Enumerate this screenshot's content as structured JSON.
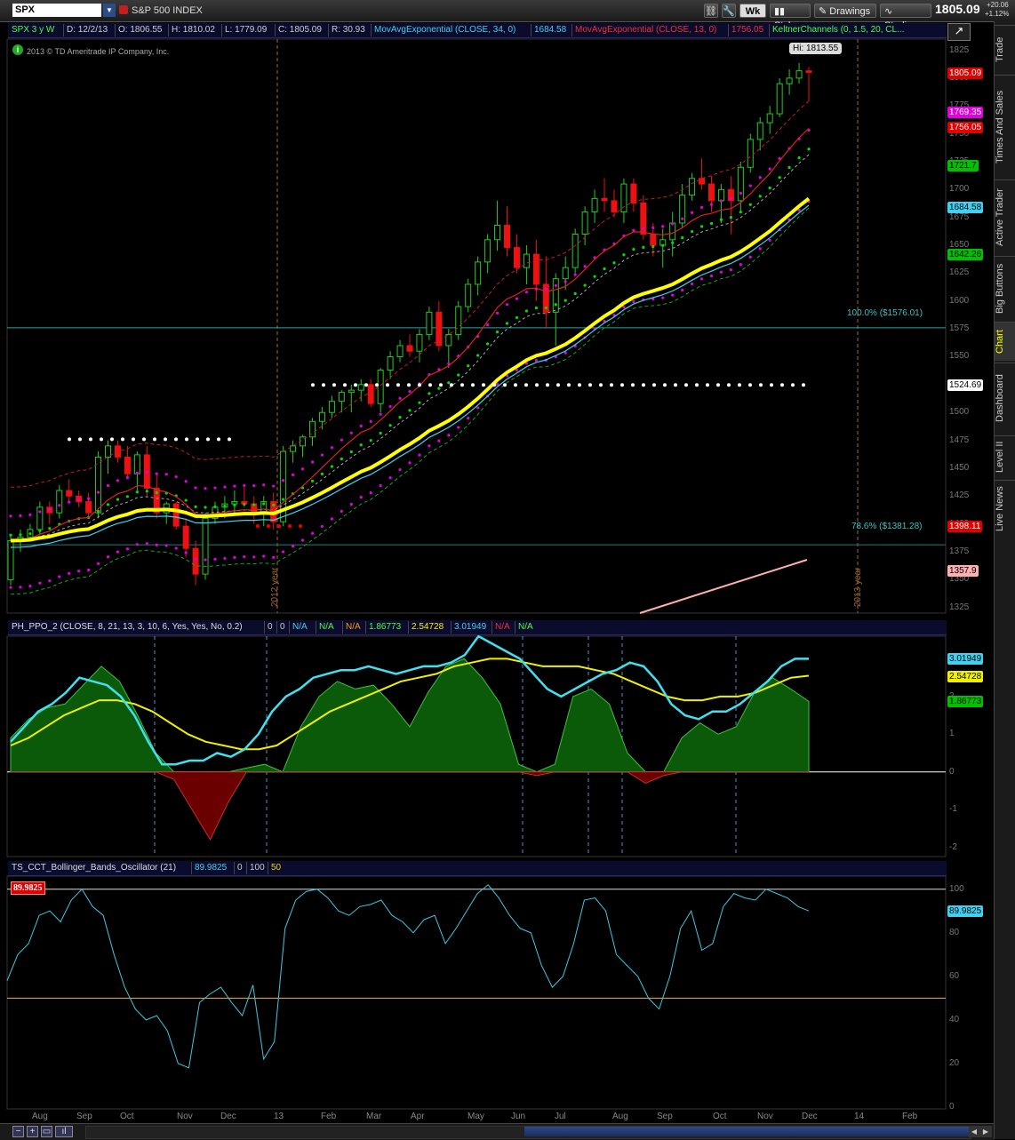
{
  "toolbar": {
    "symbol": "SPX",
    "description": "S&P 500 INDEX",
    "period_label": "Wk",
    "style_label": "Style",
    "drawings_label": "Drawings",
    "studies_label": "Studies",
    "last_price": "1805.09",
    "change": "+20.06",
    "change_pct": "+1.12%"
  },
  "sidebar": {
    "tabs": [
      "Trade",
      "Times And Sales",
      "Active Trader",
      "Big Buttons",
      "Chart",
      "Dashboard",
      "Level II",
      "Live News"
    ],
    "active": "Chart"
  },
  "price_panel": {
    "header": {
      "label": "SPX 3 y W",
      "date": "D: 12/2/13",
      "open": "O: 1806.55",
      "high": "H: 1810.02",
      "low": "L: 1779.09",
      "close": "C: 1805.09",
      "range": "R: 30.93",
      "ema34_label": "MovAvgExponential (CLOSE, 34, 0)",
      "ema34_value": "1684.58",
      "ema13_label": "MovAvgExponential (CLOSE, 13, 0)",
      "ema13_value": "1756.05",
      "keltner_label": "KeltnerChannels (0, 1.5, 20, CL..."
    },
    "copyright": "2013 © TD Ameritrade IP Company, Inc.",
    "hi_label": "Hi: 1813.55",
    "fib_100_label": "100.0%  ($1576.01)",
    "fib_786_label": "78.6%  ($1381.28)",
    "year_2012_label": "2012 year",
    "year_2013_label": "2013 year",
    "y_ticks": [
      1825,
      1800,
      1775,
      1750,
      1725,
      1700,
      1675,
      1650,
      1625,
      1600,
      1575,
      1550,
      1525,
      1500,
      1475,
      1450,
      1425,
      1400,
      1375,
      1350,
      1325
    ],
    "price_tags": [
      {
        "text": "1805.09",
        "bg": "#e00000",
        "fg": "#ffffff",
        "value": 1805.09
      },
      {
        "text": "1769.35",
        "bg": "#e000e0",
        "fg": "#ffffff",
        "value": 1769.35
      },
      {
        "text": "1756.05",
        "bg": "#e00000",
        "fg": "#ffffff",
        "value": 1756.05
      },
      {
        "text": "1721.7",
        "bg": "#00c000",
        "fg": "#000000",
        "value": 1721.7
      },
      {
        "text": "1684.58",
        "bg": "#40d0f0",
        "fg": "#000000",
        "value": 1684.58
      },
      {
        "text": "1642.26",
        "bg": "#00c000",
        "fg": "#000000",
        "value": 1642.26
      },
      {
        "text": "1524.69",
        "bg": "#ffffff",
        "fg": "#000000",
        "value": 1524.69
      },
      {
        "text": "1398.11",
        "bg": "#e00000",
        "fg": "#ffffff",
        "value": 1398.11
      },
      {
        "text": "1357.9",
        "bg": "#ffb0b0",
        "fg": "#000000",
        "value": 1357.9
      }
    ]
  },
  "ppo_panel": {
    "header": {
      "name": "PH_PPO_2 (CLOSE, 8, 21, 13, 3, 10, 6, Yes, Yes, No, 0.2)",
      "v1": "0",
      "v2": "0",
      "v3": "N/A",
      "v4": "N/A",
      "v5": "1.86773",
      "v6": "2.54728",
      "v7": "3.01949",
      "v8": "N/A",
      "v9": "N/A"
    },
    "y_ticks": [
      2,
      1,
      0,
      -1,
      -2
    ],
    "tags": [
      {
        "text": "3.01949",
        "bg": "#40d0f0",
        "fg": "#000000",
        "value": 3.01949
      },
      {
        "text": "2.54728",
        "bg": "#f0f000",
        "fg": "#000000",
        "value": 2.54728
      },
      {
        "text": "1.86773",
        "bg": "#00c000",
        "fg": "#000000",
        "value": 1.86773
      }
    ]
  },
  "bbo_panel": {
    "header": {
      "name": "TS_CCT_Bollinger_Bands_Oscillator (21)",
      "value": "89.9825",
      "p1": "0",
      "p2": "100",
      "p3": "50"
    },
    "value_box": "89.9825",
    "y_ticks": [
      100,
      80,
      60,
      40,
      20,
      0
    ],
    "tags": [
      {
        "text": "89.9825",
        "bg": "#40d0f0",
        "fg": "#000000",
        "value": 89.9825
      }
    ]
  },
  "x_axis": {
    "labels": [
      "Aug",
      "Sep",
      "Oct",
      "Nov",
      "Dec",
      "13",
      "Feb",
      "Mar",
      "Apr",
      "May",
      "Jun",
      "Jul",
      "Aug",
      "Sep",
      "Oct",
      "Nov",
      "Dec",
      "14",
      "Feb"
    ]
  },
  "chart_data": [
    {
      "type": "candlestick",
      "title": "SPX 3 y W",
      "timeframe": "weekly",
      "x_start": "2012-07-23",
      "ylim": [
        1320,
        1835
      ],
      "candles_ohlc": [
        [
          1350,
          1390,
          1345,
          1385
        ],
        [
          1385,
          1395,
          1375,
          1388
        ],
        [
          1388,
          1400,
          1385,
          1395
        ],
        [
          1395,
          1420,
          1390,
          1415
        ],
        [
          1415,
          1420,
          1400,
          1410
        ],
        [
          1410,
          1435,
          1405,
          1430
        ],
        [
          1430,
          1440,
          1420,
          1425
        ],
        [
          1425,
          1430,
          1415,
          1420
        ],
        [
          1420,
          1428,
          1405,
          1410
        ],
        [
          1410,
          1465,
          1405,
          1460
        ],
        [
          1460,
          1475,
          1445,
          1470
        ],
        [
          1470,
          1475,
          1455,
          1460
        ],
        [
          1460,
          1470,
          1440,
          1445
        ],
        [
          1445,
          1465,
          1430,
          1462
        ],
        [
          1462,
          1470,
          1425,
          1432
        ],
        [
          1432,
          1445,
          1405,
          1410
        ],
        [
          1410,
          1420,
          1400,
          1418
        ],
        [
          1418,
          1420,
          1395,
          1398
        ],
        [
          1398,
          1405,
          1370,
          1378
        ],
        [
          1378,
          1385,
          1345,
          1355
        ],
        [
          1355,
          1410,
          1350,
          1405
        ],
        [
          1405,
          1420,
          1400,
          1415
        ],
        [
          1415,
          1425,
          1405,
          1418
        ],
        [
          1418,
          1430,
          1410,
          1420
        ],
        [
          1420,
          1435,
          1415,
          1418
        ],
        [
          1418,
          1425,
          1400,
          1410
        ],
        [
          1410,
          1425,
          1398,
          1420
        ],
        [
          1420,
          1428,
          1395,
          1402
        ],
        [
          1402,
          1470,
          1398,
          1465
        ],
        [
          1465,
          1475,
          1455,
          1470
        ],
        [
          1470,
          1480,
          1460,
          1478
        ],
        [
          1478,
          1495,
          1470,
          1492
        ],
        [
          1492,
          1505,
          1485,
          1500
        ],
        [
          1500,
          1515,
          1495,
          1510
        ],
        [
          1510,
          1520,
          1500,
          1518
        ],
        [
          1518,
          1525,
          1500,
          1520
        ],
        [
          1520,
          1530,
          1510,
          1525
        ],
        [
          1525,
          1530,
          1505,
          1508
        ],
        [
          1508,
          1540,
          1500,
          1538
        ],
        [
          1538,
          1555,
          1530,
          1550
        ],
        [
          1550,
          1565,
          1545,
          1560
        ],
        [
          1560,
          1570,
          1550,
          1555
        ],
        [
          1555,
          1575,
          1545,
          1570
        ],
        [
          1570,
          1595,
          1565,
          1590
        ],
        [
          1590,
          1600,
          1555,
          1560
        ],
        [
          1560,
          1575,
          1540,
          1570
        ],
        [
          1570,
          1600,
          1565,
          1595
        ],
        [
          1595,
          1620,
          1590,
          1615
        ],
        [
          1615,
          1640,
          1605,
          1635
        ],
        [
          1635,
          1660,
          1625,
          1655
        ],
        [
          1655,
          1690,
          1645,
          1668
        ],
        [
          1668,
          1685,
          1640,
          1648
        ],
        [
          1648,
          1660,
          1625,
          1630
        ],
        [
          1630,
          1650,
          1615,
          1642
        ],
        [
          1642,
          1655,
          1600,
          1615
        ],
        [
          1615,
          1640,
          1575,
          1590
        ],
        [
          1590,
          1625,
          1560,
          1620
        ],
        [
          1620,
          1640,
          1610,
          1630
        ],
        [
          1630,
          1665,
          1625,
          1660
        ],
        [
          1660,
          1685,
          1650,
          1680
        ],
        [
          1680,
          1700,
          1670,
          1692
        ],
        [
          1692,
          1710,
          1680,
          1690
        ],
        [
          1690,
          1700,
          1675,
          1680
        ],
        [
          1680,
          1710,
          1670,
          1705
        ],
        [
          1705,
          1710,
          1680,
          1688
        ],
        [
          1688,
          1695,
          1655,
          1660
        ],
        [
          1660,
          1670,
          1640,
          1650
        ],
        [
          1650,
          1665,
          1630,
          1655
        ],
        [
          1655,
          1680,
          1640,
          1670
        ],
        [
          1670,
          1705,
          1665,
          1695
        ],
        [
          1695,
          1715,
          1690,
          1710
        ],
        [
          1710,
          1728,
          1700,
          1705
        ],
        [
          1705,
          1712,
          1680,
          1690
        ],
        [
          1690,
          1705,
          1670,
          1700
        ],
        [
          1700,
          1712,
          1660,
          1690
        ],
        [
          1690,
          1725,
          1680,
          1720
        ],
        [
          1720,
          1750,
          1715,
          1745
        ],
        [
          1745,
          1765,
          1735,
          1760
        ],
        [
          1760,
          1775,
          1750,
          1768
        ],
        [
          1768,
          1800,
          1765,
          1795
        ],
        [
          1795,
          1808,
          1785,
          1800
        ],
        [
          1800,
          1813.55,
          1795,
          1806.55
        ],
        [
          1806.55,
          1810.02,
          1779.09,
          1805.09
        ]
      ],
      "ema13_endpoints": [
        1360,
        1756.05
      ],
      "ema34_endpoints": [
        1345,
        1684.58
      ],
      "keltner_upper_last": 1769.35,
      "keltner_lower_last": 1721.7,
      "fib_levels": [
        {
          "label": "100.0%",
          "value": 1576.01
        },
        {
          "label": "78.6%",
          "value": 1381.28
        }
      ]
    },
    {
      "type": "area",
      "title": "PH_PPO_2 (CLOSE, 8, 21, 13, 3, 10, 6, Yes, Yes, No, 0.2)",
      "ylim": [
        -2.2,
        3.6
      ],
      "series": [
        {
          "name": "PPO",
          "color": "#40d0f0",
          "values": [
            0.8,
            1.2,
            1.6,
            1.8,
            2.1,
            2.5,
            2.4,
            2.3,
            2.0,
            1.5,
            0.8,
            0.2,
            0.2,
            0.3,
            0.3,
            0.5,
            0.4,
            0.6,
            1.0,
            1.6,
            2.0,
            2.2,
            2.5,
            2.6,
            2.7,
            2.7,
            2.8,
            2.7,
            2.6,
            2.7,
            2.8,
            2.8,
            2.9,
            3.1,
            3.6,
            3.4,
            3.2,
            3.0,
            2.6,
            2.2,
            2.0,
            2.2,
            2.4,
            2.6,
            2.7,
            2.9,
            2.8,
            2.4,
            1.8,
            1.5,
            1.4,
            1.6,
            1.6,
            1.8,
            2.1,
            2.4,
            2.8,
            3.0,
            3.0
          ]
        },
        {
          "name": "Signal",
          "color": "#f0f000",
          "values": [
            0.7,
            0.9,
            1.2,
            1.5,
            1.7,
            1.9,
            1.9,
            1.8,
            1.6,
            1.3,
            1.0,
            0.8,
            0.7,
            0.6,
            0.6,
            0.7,
            1.0,
            1.3,
            1.6,
            1.8,
            2.0,
            2.2,
            2.4,
            2.5,
            2.6,
            2.8,
            2.9,
            3.0,
            3.0,
            2.9,
            2.8,
            2.8,
            2.8,
            2.7,
            2.6,
            2.4,
            2.2,
            2.0,
            1.9,
            1.9,
            2.0,
            2.0,
            2.1,
            2.3,
            2.5,
            2.55
          ]
        },
        {
          "name": "Histogram",
          "color": "#0a6a0a",
          "values": [
            0.9,
            1.4,
            1.7,
            1.8,
            2.3,
            2.8,
            2.4,
            1.5,
            0.5,
            -0.2,
            -1.0,
            -1.8,
            -0.8,
            0.1,
            0.2,
            0.0,
            1.2,
            2.0,
            2.4,
            2.2,
            2.3,
            1.8,
            1.2,
            2.1,
            2.8,
            3.0,
            2.5,
            1.8,
            0.2,
            -0.1,
            0.2,
            2.0,
            2.2,
            1.8,
            0.5,
            -0.3,
            -0.1,
            0.9,
            1.3,
            1.0,
            1.2,
            2.1,
            2.5,
            2.2,
            1.87
          ]
        }
      ],
      "zero_line": true
    },
    {
      "type": "line",
      "title": "TS_CCT_Bollinger_Bands_Oscillator (21)",
      "ylim": [
        0,
        106
      ],
      "hlines": [
        100,
        50
      ],
      "series": [
        {
          "name": "BBO",
          "color": "#40d0f0",
          "values": [
            58,
            70,
            75,
            88,
            90,
            85,
            95,
            100,
            92,
            88,
            70,
            55,
            45,
            40,
            42,
            35,
            20,
            18,
            48,
            52,
            55,
            48,
            42,
            56,
            22,
            30,
            82,
            95,
            99,
            100,
            96,
            90,
            88,
            92,
            93,
            95,
            88,
            85,
            80,
            86,
            88,
            75,
            82,
            90,
            98,
            102,
            96,
            88,
            82,
            80,
            65,
            55,
            60,
            75,
            95,
            96,
            90,
            70,
            65,
            60,
            50,
            45,
            60,
            82,
            90,
            72,
            75,
            92,
            98,
            96,
            95,
            100,
            98,
            96,
            92,
            90
          ]
        }
      ]
    }
  ]
}
